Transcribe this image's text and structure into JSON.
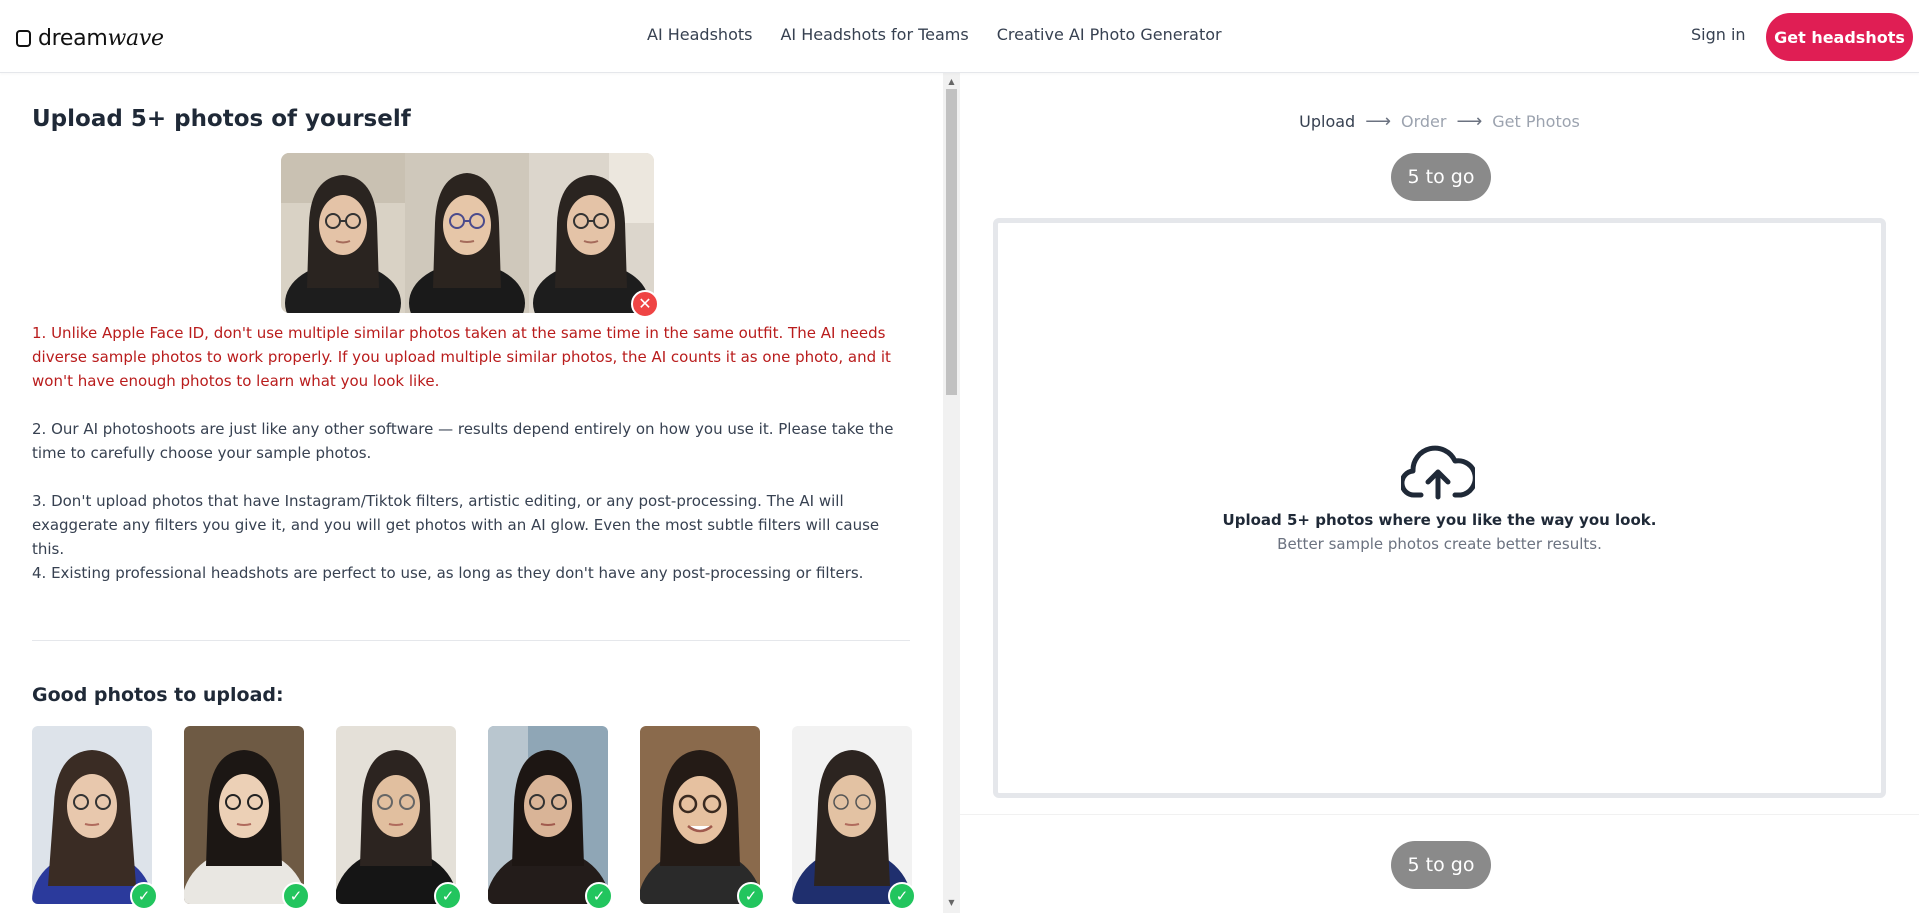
{
  "header": {
    "logo_text": "dreamwave",
    "nav": [
      "AI Headshots",
      "AI Headshots for Teams",
      "Creative AI Photo Generator"
    ],
    "sign_in": "Sign in",
    "cta": "Get headshots"
  },
  "left": {
    "title": "Upload 5+ photos of yourself",
    "tips": [
      "1. Unlike Apple Face ID, don't use multiple similar photos taken at the same time in the same outfit. The AI needs diverse sample photos to work properly. If you upload multiple similar photos, the AI counts it as one photo, and it won't have enough photos to learn what you look like.",
      "2. Our AI photoshoots are just like any other software — results depend entirely on how you use it. Please take the time to carefully choose your sample photos.",
      "3. Don't upload photos that have Instagram/Tiktok filters, artistic editing, or any post-processing. The AI will exaggerate any filters you give it, and you will get photos with an AI glow. Even the most subtle filters will cause this.",
      "4. Existing professional headshots are perfect to use, as long as they don't have any post-processing or filters."
    ],
    "good_title": "Good photos to upload:",
    "bad_badge_icon": "x-icon",
    "good_badge_icon": "check-icon"
  },
  "right": {
    "steps": [
      "Upload",
      "Order",
      "Get Photos"
    ],
    "counter_top": "5 to go",
    "counter_bottom": "5 to go",
    "drop_title": "Upload 5+ photos where you like the way you look.",
    "drop_sub": "Better sample photos create better results.",
    "drop_icon": "cloud-upload-icon"
  },
  "colors": {
    "brand": "#e01e54",
    "warning_text": "#b91c1c",
    "check": "#22c55e",
    "x_badge": "#ef4444",
    "pill": "#8a8a8a"
  }
}
